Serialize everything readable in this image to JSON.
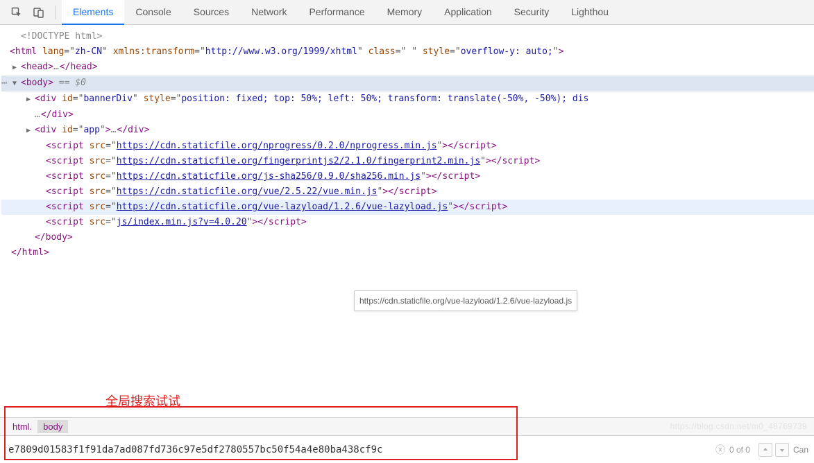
{
  "toolbar": {
    "tabs": [
      "Elements",
      "Console",
      "Sources",
      "Network",
      "Performance",
      "Memory",
      "Application",
      "Security",
      "Lighthou"
    ],
    "active_tab_index": 0
  },
  "dom": {
    "doctype": "<!DOCTYPE html>",
    "html_open": {
      "tag": "html",
      "attrs": [
        {
          "name": "lang",
          "value": "zh-CN"
        },
        {
          "name": "xmlns:transform",
          "value": "http://www.w3.org/1999/xhtml"
        },
        {
          "name": "class",
          "value": " "
        },
        {
          "name": "style",
          "value": "overflow-y: auto;"
        }
      ]
    },
    "head": {
      "open_tag": "head",
      "ellipsis": "…",
      "close_tag": "head"
    },
    "body_open": {
      "tag": "body",
      "selected_note": "== $0"
    },
    "banner_div": {
      "tag": "div",
      "attrs": [
        {
          "name": "id",
          "value": "bannerDiv"
        },
        {
          "name": "style",
          "value": "position: fixed; top: 50%; left: 50%; transform: translate(-50%, -50%); dis"
        }
      ],
      "cont_ellipsis": "…",
      "close_tag": "div"
    },
    "app_div": {
      "tag": "div",
      "attrs": [
        {
          "name": "id",
          "value": "app"
        }
      ],
      "ellipsis": "…",
      "close_tag": "div"
    },
    "scripts": [
      {
        "src": "https://cdn.staticfile.org/nprogress/0.2.0/nprogress.min.js"
      },
      {
        "src": "https://cdn.staticfile.org/fingerprintjs2/2.1.0/fingerprint2.min.js"
      },
      {
        "src": "https://cdn.staticfile.org/js-sha256/0.9.0/sha256.min.js"
      },
      {
        "src": "https://cdn.staticfile.org/vue/2.5.22/vue.min.js"
      },
      {
        "src": "https://cdn.staticfile.org/vue-lazyload/1.2.6/vue-lazyload.js",
        "hovered": true
      },
      {
        "src": "js/index.min.js?v=4.0.20"
      }
    ],
    "body_close": "body",
    "html_close": "html"
  },
  "tooltip": "https://cdn.staticfile.org/vue-lazyload/1.2.6/vue-lazyload.js",
  "annotation": "全局搜索试试",
  "breadcrumb": [
    "html.",
    "body"
  ],
  "breadcrumb_active_index": 1,
  "search": {
    "value": "e7809d01583f1f91da7ad087fd736c97e5df2780557bc50f54a4e80ba438cf9c",
    "status": "0 of 0"
  },
  "watermark": "https://blog.csdn.net/m0_48769739"
}
